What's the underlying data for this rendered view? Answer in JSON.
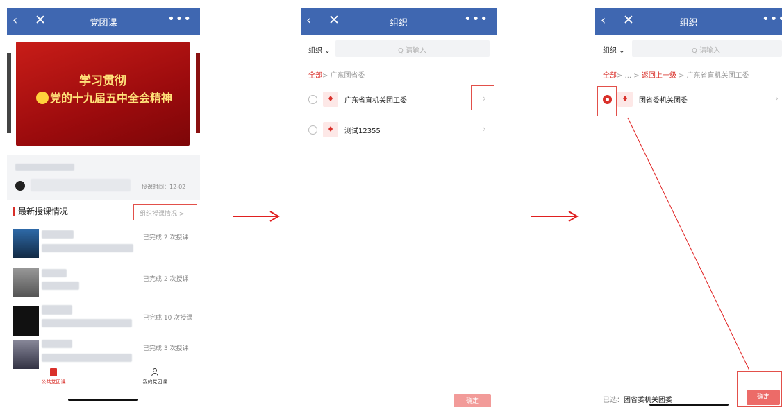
{
  "phone1": {
    "title": "党团课",
    "banner_line1": "学习贯彻",
    "banner_line2": "党的十九届五中全会精神",
    "class_time": "授课时间：12-02",
    "section_title": "最新授课情况",
    "org_button": "组织授课情况 >",
    "rows": [
      {
        "status": "已完成 2 次授课"
      },
      {
        "status": "已完成 2 次授课"
      },
      {
        "status": "已完成 10 次授课"
      },
      {
        "status": "已完成 3 次授课"
      }
    ],
    "tabs": [
      {
        "label": "公共党团课",
        "icon": "public-course-icon"
      },
      {
        "label": "我的党团课",
        "icon": "user-icon"
      }
    ]
  },
  "phone2": {
    "title": "组织",
    "org_selector": "组织 ⌄",
    "search_placeholder": "Q 请输入",
    "breadcrumb_all": "全部",
    "breadcrumb_rest": "> 广东团省委",
    "items": [
      {
        "name": "广东省直机关团工委"
      },
      {
        "name": "测试12355"
      }
    ],
    "confirm": "确定"
  },
  "phone3": {
    "title": "组织",
    "org_selector": "组织 ⌄",
    "search_placeholder": "Q 请输入",
    "breadcrumb_all": "全部",
    "breadcrumb_mid": "> ... >",
    "breadcrumb_back": "返回上一级",
    "breadcrumb_rest": "> 广东省直机关团工委",
    "items": [
      {
        "name": "团省委机关团委"
      }
    ],
    "selected_label": "已选：",
    "selected_value": "团省委机关团委",
    "confirm": "确定"
  },
  "colors": {
    "header": "#3f67b1",
    "accent": "#d9302a"
  }
}
